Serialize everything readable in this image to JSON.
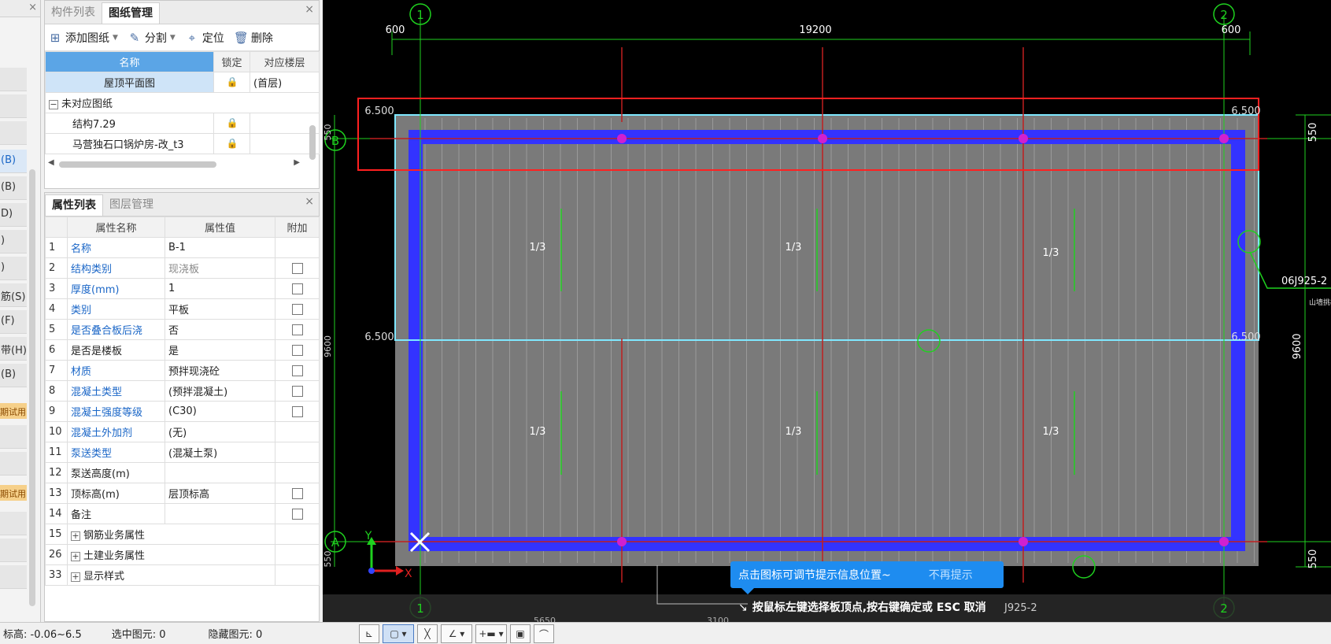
{
  "left_strip": {
    "close": "×",
    "items": [
      {
        "label": "",
        "sel": false
      },
      {
        "label": "",
        "sel": false
      },
      {
        "label": "",
        "sel": false
      },
      {
        "label": "(B)",
        "sel": true
      },
      {
        "label": "(B)",
        "sel": false
      },
      {
        "label": "D)",
        "sel": false
      },
      {
        "label": ")",
        "sel": false
      },
      {
        "label": ")",
        "sel": false
      },
      {
        "label": "筋(S)",
        "sel": false
      },
      {
        "label": "(F)",
        "sel": false
      },
      {
        "label": "带(H)",
        "sel": false
      },
      {
        "label": "(B)",
        "sel": false
      }
    ],
    "badges": [
      "期试用",
      "期试用"
    ]
  },
  "drawing_panel": {
    "tabs": [
      {
        "label": "构件列表",
        "active": false
      },
      {
        "label": "图纸管理",
        "active": true
      }
    ],
    "close": "×",
    "toolbar": {
      "add": "添加图纸",
      "split": "分割",
      "locate": "定位",
      "delete": "删除"
    },
    "columns": [
      "名称",
      "锁定",
      "对应楼层"
    ],
    "rows": [
      {
        "name": "屋顶平面图",
        "floor": "(首层)",
        "selected": true
      }
    ],
    "group": {
      "sign": "−",
      "label": "未对应图纸"
    },
    "children": [
      {
        "name": "结构7.29"
      },
      {
        "name": "马营独石口锅炉房-改_t3"
      }
    ]
  },
  "prop_panel": {
    "tabs": [
      {
        "label": "属性列表",
        "active": true
      },
      {
        "label": "图层管理",
        "active": false
      }
    ],
    "close": "×",
    "columns": [
      "属性名称",
      "属性值",
      "附加"
    ],
    "rows": [
      {
        "num": "1",
        "name": "名称",
        "value": "B-1",
        "blue": true,
        "cb": false,
        "gray": false
      },
      {
        "num": "2",
        "name": "结构类别",
        "value": "现浇板",
        "blue": true,
        "cb": true,
        "gray": true
      },
      {
        "num": "3",
        "name": "厚度(mm)",
        "value": "1",
        "blue": true,
        "cb": true,
        "gray": false
      },
      {
        "num": "4",
        "name": "类别",
        "value": "平板",
        "blue": true,
        "cb": true,
        "gray": false
      },
      {
        "num": "5",
        "name": "是否叠合板后浇",
        "value": "否",
        "blue": true,
        "cb": true,
        "gray": false
      },
      {
        "num": "6",
        "name": "是否是楼板",
        "value": "是",
        "blue": false,
        "cb": true,
        "gray": false
      },
      {
        "num": "7",
        "name": "材质",
        "value": "预拌现浇砼",
        "blue": true,
        "cb": true,
        "gray": false
      },
      {
        "num": "8",
        "name": "混凝土类型",
        "value": "(预拌混凝土)",
        "blue": true,
        "cb": true,
        "gray": false
      },
      {
        "num": "9",
        "name": "混凝土强度等级",
        "value": "(C30)",
        "blue": true,
        "cb": true,
        "gray": false
      },
      {
        "num": "10",
        "name": "混凝土外加剂",
        "value": "(无)",
        "blue": true,
        "cb": false,
        "gray": false
      },
      {
        "num": "11",
        "name": "泵送类型",
        "value": "(混凝土泵)",
        "blue": true,
        "cb": false,
        "gray": false
      },
      {
        "num": "12",
        "name": "泵送高度(m)",
        "value": "",
        "blue": false,
        "cb": false,
        "gray": false
      },
      {
        "num": "13",
        "name": "顶标高(m)",
        "value": "层顶标高",
        "blue": false,
        "cb": true,
        "gray": false
      },
      {
        "num": "14",
        "name": "备注",
        "value": "",
        "blue": false,
        "cb": true,
        "gray": false
      }
    ],
    "groups": [
      {
        "num": "15",
        "name": "钢筋业务属性"
      },
      {
        "num": "26",
        "name": "土建业务属性"
      },
      {
        "num": "33",
        "name": "显示样式"
      }
    ]
  },
  "cad": {
    "axis_top": [
      "1",
      "2"
    ],
    "axis_left": [
      "B",
      "A"
    ],
    "dims_top": [
      "600",
      "19200",
      "600"
    ],
    "dims_right": [
      "550",
      "9600",
      "550"
    ],
    "dims_left": [
      "550",
      "9600",
      "550"
    ],
    "elevations": [
      "6.500",
      "6.500",
      "6.500",
      "6.500"
    ],
    "ratios": [
      "1/3",
      "1/3",
      "1/3",
      "1/3",
      "1/3",
      "1/3"
    ],
    "ref": "06J925-2",
    "ref2": "J925-2",
    "ref_small": "山墙挑檐",
    "bottom_dims": [
      "5650",
      "3100"
    ],
    "axis_xy": [
      "X",
      "Y"
    ]
  },
  "tip": {
    "text": "点击图标可调节提示信息位置~",
    "dismiss": "不再提示"
  },
  "hint": {
    "icon": "↘",
    "text": "按鼠标左键选择板顶点,按右键确定或 ESC 取消"
  },
  "status": {
    "elevation": "标高:  -0.06~6.5",
    "selected": "选中图元:  0",
    "hidden": "隐藏图元:  0",
    "tools": [
      "⊾",
      "▢ ▾",
      "╳",
      "∠ ▾",
      "+▬ ▾",
      "▣",
      "⌒"
    ]
  }
}
